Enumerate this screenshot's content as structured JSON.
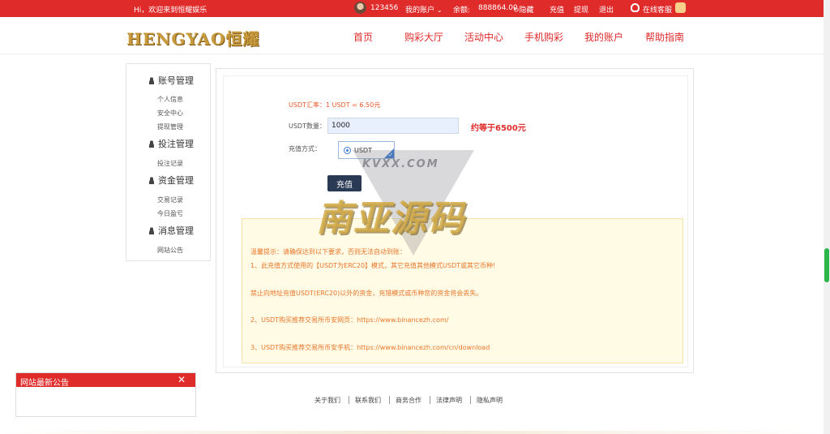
{
  "topbar": {
    "welcome": "Hi，欢迎来到恒耀娱乐",
    "username": "123456",
    "my_account": "我的账户",
    "balance_label": "余额:",
    "balance_value": "888864.00",
    "hide": "隐藏",
    "deposit": "充值",
    "withdraw": "提现",
    "logout": "退出",
    "online_service": "在线客服"
  },
  "header": {
    "logo_text": "HENGYAO恒耀",
    "nav": [
      "首页",
      "购彩大厅",
      "活动中心",
      "手机购彩",
      "我的账户",
      "帮助指南"
    ]
  },
  "sidebar": {
    "sections": [
      {
        "title": "账号管理",
        "items": [
          "个人信息",
          "安全中心",
          "提现管理"
        ]
      },
      {
        "title": "投注管理",
        "items": [
          "投注记录"
        ]
      },
      {
        "title": "资金管理",
        "items": [
          "交易记录",
          "今日盈亏"
        ]
      },
      {
        "title": "消息管理",
        "items": [
          "网站公告"
        ]
      }
    ]
  },
  "form": {
    "rate_text": "USDT汇率：1 USDT = 6.50元",
    "qty_label": "USDT数量：",
    "qty_value": "1000",
    "approx_text": "约等于6500元",
    "method_label": "充值方式：",
    "method_option": "USDT",
    "submit_label": "充值"
  },
  "notice": {
    "lines": [
      "温馨提示：请确保达到以下要求，否则无法自动到账：",
      "1、此充值方式使用的【USDT为ERC20】模式，其它充值其他模式USDT或其它币种!",
      "禁止向地址充值USDT(ERC20)以外的资金，充错模式或币种您的资金将会丢失。",
      "2、USDT购买推荐交易所币安网页：https://www.binancezh.com/",
      "3、USDT购买推荐交易所币安手机：https://www.binancezh.com/cn/download"
    ]
  },
  "watermark": {
    "small": "KVXX.COM",
    "big": "南亚源码"
  },
  "footer": {
    "links": [
      "关于我们",
      "联系我们",
      "商务合作",
      "法律声明",
      "隐私声明"
    ]
  },
  "announcement": {
    "title": "网站最新公告",
    "close": "✕"
  },
  "colors": {
    "brand_red": "#e02b2b",
    "notice_bg": "#fffbe5",
    "notice_text": "#e8762b",
    "button_dark": "#2a3a55"
  }
}
